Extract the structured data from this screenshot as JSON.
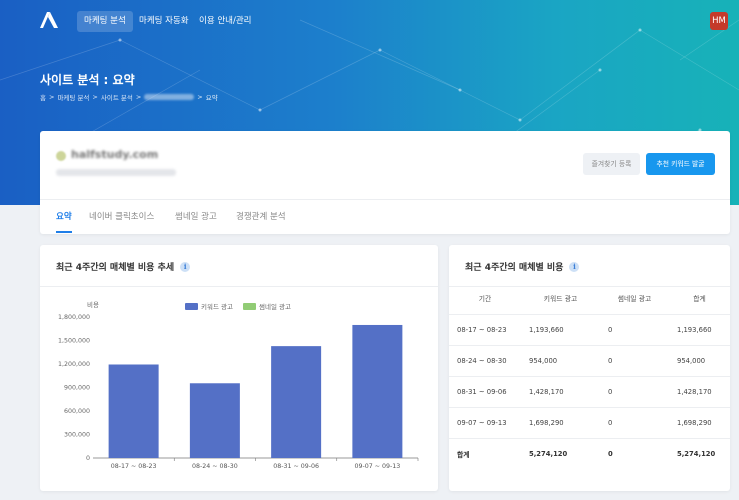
{
  "nav": {
    "items": [
      "마케팅 분석",
      "마케팅 자동화",
      "이용 안내/관리"
    ],
    "avatar": "HM"
  },
  "header": {
    "title": "사이트 분석 : 요약",
    "breadcrumb": [
      "홈",
      "마케팅 분석",
      "사이트 분석",
      "요약"
    ]
  },
  "site": {
    "name": "halfstudy.com",
    "fav_button": "즐겨찾기 등록",
    "keyword_button": "추천 키워드 발굴"
  },
  "tabs": [
    "요약",
    "네이버 클릭초이스",
    "썸네일 광고",
    "경쟁관계 분석"
  ],
  "trend": {
    "title": "최근 4주간의 매체별 비용 추세",
    "info": "i"
  },
  "chart_data": {
    "type": "bar",
    "ylabel": "비용",
    "categories": [
      "08-17 ~ 08-23",
      "08-24 ~ 08-30",
      "08-31 ~ 09-06",
      "09-07 ~ 09-13"
    ],
    "series": [
      {
        "name": "키워드 광고",
        "values": [
          1193660,
          954000,
          1428170,
          1698290
        ],
        "color": "#5470c6"
      },
      {
        "name": "썸네일 광고",
        "values": [
          0,
          0,
          0,
          0
        ],
        "color": "#91cc75"
      }
    ],
    "ylim": [
      0,
      1800000
    ],
    "yticks": [
      "0",
      "300,000",
      "600,000",
      "900,000",
      "1,200,000",
      "1,500,000",
      "1,800,000"
    ],
    "legend": "top-center",
    "grid": false
  },
  "cost": {
    "title": "최근 4주간의 매체별 비용",
    "info": "i",
    "headers": [
      "기간",
      "키워드 광고",
      "썸네일 광고",
      "합계"
    ],
    "rows": [
      [
        "08-17 ~ 08-23",
        "1,193,660",
        "0",
        "1,193,660"
      ],
      [
        "08-24 ~ 08-30",
        "954,000",
        "0",
        "954,000"
      ],
      [
        "08-31 ~ 09-06",
        "1,428,170",
        "0",
        "1,428,170"
      ],
      [
        "09-07 ~ 09-13",
        "1,698,290",
        "0",
        "1,698,290"
      ]
    ],
    "total": [
      "합계",
      "5,274,120",
      "0",
      "5,274,120"
    ]
  }
}
